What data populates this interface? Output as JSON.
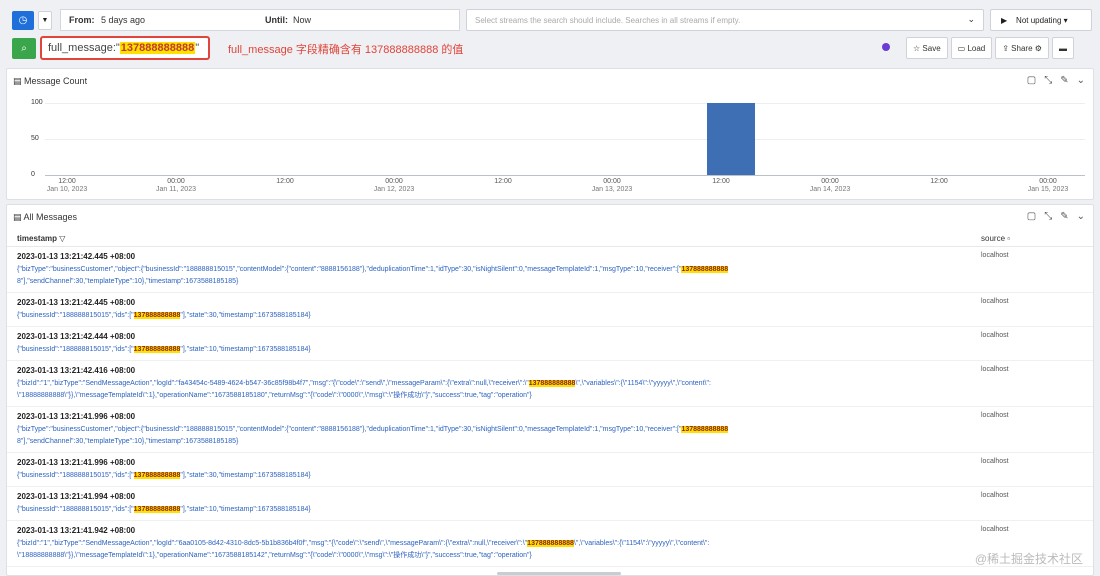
{
  "toolbar": {
    "time_from_label": "From:",
    "time_from_value": "5 days ago",
    "time_until_label": "Until:",
    "time_until_value": "Now",
    "stream_placeholder": "Select streams the search should include. Searches in all streams if empty.",
    "updating_label": "Not updating",
    "query_prefix": "full_message:\"",
    "query_value": "137888888888",
    "query_suffix": "\"",
    "annotation": "full_message 字段精确含有 137888888888 的值",
    "save_label": "Save",
    "load_label": "Load",
    "share_label": "Share"
  },
  "message_count": {
    "title": "Message Count",
    "chart_data": {
      "type": "bar",
      "y_ticks": [
        "100",
        "50",
        "0"
      ],
      "ylim": [
        0,
        100
      ],
      "x_ticks": [
        {
          "time": "12:00",
          "date": "Jan 10, 2023"
        },
        {
          "time": "00:00",
          "date": "Jan 11, 2023"
        },
        {
          "time": "12:00",
          "date": ""
        },
        {
          "time": "00:00",
          "date": "Jan 12, 2023"
        },
        {
          "time": "12:00",
          "date": ""
        },
        {
          "time": "00:00",
          "date": "Jan 13, 2023"
        },
        {
          "time": "12:00",
          "date": ""
        },
        {
          "time": "00:00",
          "date": "Jan 14, 2023"
        },
        {
          "time": "12:00",
          "date": ""
        },
        {
          "time": "00:00",
          "date": "Jan 15, 2023"
        }
      ],
      "bars": [
        {
          "x": "2023-01-13 13:00",
          "value": 100
        },
        {
          "x": "2023-01-13 14:00",
          "value": 100
        }
      ]
    }
  },
  "all_messages": {
    "title": "All Messages",
    "col_timestamp": "timestamp",
    "col_source": "source",
    "rows": [
      {
        "ts": "2023-01-13 13:21:42.445 +08:00",
        "source": "localhost",
        "line1": "{\"bizType\":\"businessCustomer\",\"object\":{\"businessId\":\"188888815015\",\"contentModel\":{\"content\":\"8888156188\"},\"deduplicationTime\":1,\"idType\":30,\"isNightSilent\":0,\"messageTemplateId\":1,\"msgType\":10,\"receiver\":[\"",
        "hl1": "137888888888",
        "tail1": "",
        "line2": "8\"],\"sendChannel\":30,\"templateType\":10},\"timestamp\":1673588185185}",
        "hl2": "",
        "tail2": ""
      },
      {
        "ts": "2023-01-13 13:21:42.445 +08:00",
        "source": "localhost",
        "line1": "{\"businessId\":\"188888815015\",\"ids\":[\"",
        "hl1": "137888888888",
        "tail1": "\"],\"state\":30,\"timestamp\":1673588185184}",
        "line2": "",
        "hl2": "",
        "tail2": ""
      },
      {
        "ts": "2023-01-13 13:21:42.444 +08:00",
        "source": "localhost",
        "line1": "{\"businessId\":\"188888815015\",\"ids\":[\"",
        "hl1": "137888888888",
        "tail1": "\"],\"state\":10,\"timestamp\":1673588185184}",
        "line2": "",
        "hl2": "",
        "tail2": ""
      },
      {
        "ts": "2023-01-13 13:21:42.416 +08:00",
        "source": "localhost",
        "line1": "{\"bizId\":\"1\",\"bizType\":\"SendMessageAction\",\"logId\":\"fa43454c-5489-4624-b547-36c85f98b4f7\",\"msg\":\"{\\\"code\\\":\\\"send\\\",\\\"messageParam\\\":{\\\"extra\\\":null,\\\"receiver\\\":\\\"",
        "hl1": "137888888888",
        "tail1": "\\\",\\\"variables\\\":{\\\"1154\\\":\\\"yyyyy\\\",\\\"content\\\":",
        "line2": "\\\"18888888888\\\"}},\\\"messageTemplateId\\\":1},\"operationName\":\"1673588185180\",\"returnMsg\":\"{\\\"code\\\":\\\"0000\\\",\\\"msg\\\":\\\"操作成功\\\"}\",\"success\":true,\"tag\":\"operation\"}",
        "hl2": "",
        "tail2": ""
      },
      {
        "ts": "2023-01-13 13:21:41.996 +08:00",
        "source": "localhost",
        "line1": "{\"bizType\":\"businessCustomer\",\"object\":{\"businessId\":\"188888815015\",\"contentModel\":{\"content\":\"8888156188\"},\"deduplicationTime\":1,\"idType\":30,\"isNightSilent\":0,\"messageTemplateId\":1,\"msgType\":10,\"receiver\":[\"",
        "hl1": "137888888888",
        "tail1": "",
        "line2": "8\"],\"sendChannel\":30,\"templateType\":10},\"timestamp\":1673588185185}",
        "hl2": "",
        "tail2": ""
      },
      {
        "ts": "2023-01-13 13:21:41.996 +08:00",
        "source": "localhost",
        "line1": "{\"businessId\":\"188888815015\",\"ids\":[\"",
        "hl1": "137888888888",
        "tail1": "\"],\"state\":30,\"timestamp\":1673588185184}",
        "line2": "",
        "hl2": "",
        "tail2": ""
      },
      {
        "ts": "2023-01-13 13:21:41.994 +08:00",
        "source": "localhost",
        "line1": "{\"businessId\":\"188888815015\",\"ids\":[\"",
        "hl1": "137888888888",
        "tail1": "\"],\"state\":10,\"timestamp\":1673588185184}",
        "line2": "",
        "hl2": "",
        "tail2": ""
      },
      {
        "ts": "2023-01-13 13:21:41.942 +08:00",
        "source": "localhost",
        "line1": "{\"bizId\":\"1\",\"bizType\":\"SendMessageAction\",\"logId\":\"6aa0105-8d42-4310-8dc5-5b1b836b4f0f\",\"msg\":\"{\\\"code\\\":\\\"send\\\",\\\"messageParam\\\":{\\\"extra\\\":null,\\\"receiver\\\":\\\"",
        "hl1": "137888888888",
        "tail1": "\\\",\\\"variables\\\":{\\\"1154\\\":\\\"yyyyy\\\",\\\"content\\\":",
        "line2": "\\\"18888888888\\\"}},\\\"messageTemplateId\\\":1},\"operationName\":\"1673588185142\",\"returnMsg\":\"{\\\"code\\\":\\\"0000\\\",\\\"msg\\\":\\\"操作成功\\\"}\",\"success\":true,\"tag\":\"operation\"}",
        "hl2": "",
        "tail2": ""
      }
    ]
  },
  "watermark": "@稀土掘金技术社区"
}
